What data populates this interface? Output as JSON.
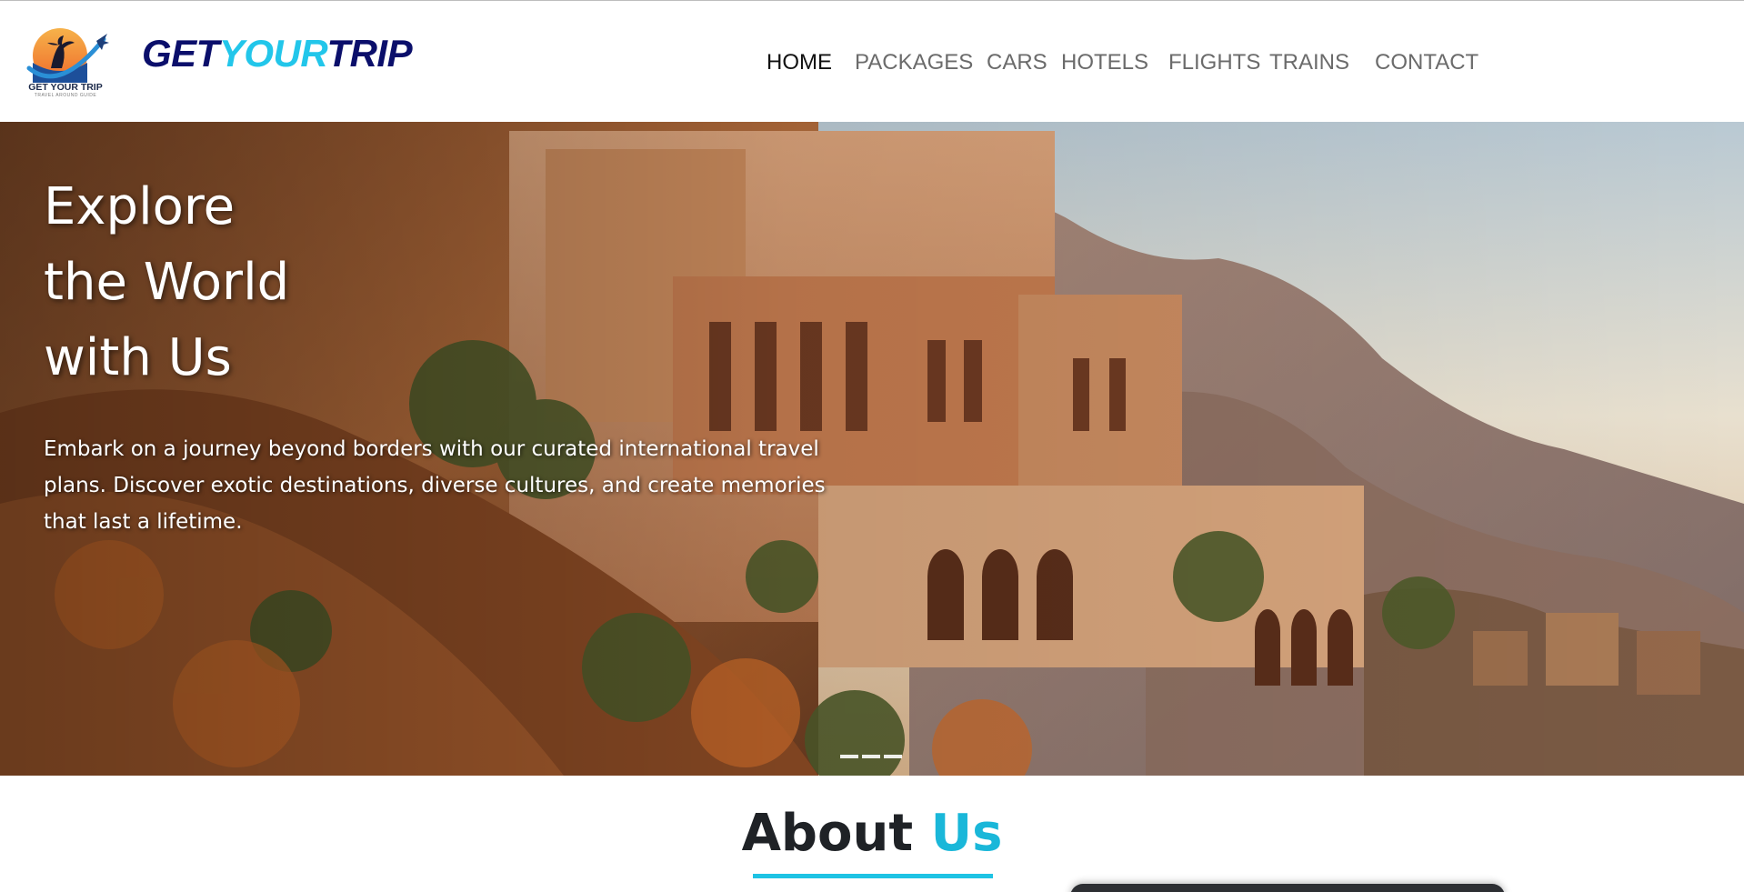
{
  "brand": {
    "logo_text": "GET YOUR TRIP",
    "logo_subtext": "TRAVEL AROUND GUIDE",
    "name_part1": "GET",
    "name_part2": "YOUR",
    "name_part3": "TRIP",
    "colors": {
      "navy": "#0b0f6b",
      "cyan": "#22c6ea"
    }
  },
  "nav": {
    "items": [
      {
        "label": "HOME",
        "active": true
      },
      {
        "label": "PACKAGES",
        "active": false
      },
      {
        "label": "CARS",
        "active": false
      },
      {
        "label": "HOTELS",
        "active": false
      },
      {
        "label": "FLIGHTS",
        "active": false
      },
      {
        "label": "TRAINS",
        "active": false
      },
      {
        "label": "CONTACT",
        "active": false
      }
    ]
  },
  "hero": {
    "title_line1": "Explore",
    "title_line2": "the World",
    "title_line3": "with Us",
    "description": "Embark on a journey beyond borders with our curated international travel plans. Discover exotic destinations, diverse cultures, and create memories that last a lifetime.",
    "slides": 3,
    "active_slide": 1,
    "image": "desert-cliff-palace-photo"
  },
  "about": {
    "title_part1": "About",
    "title_part2": "Us",
    "accent_color": "#1ab7d9"
  }
}
